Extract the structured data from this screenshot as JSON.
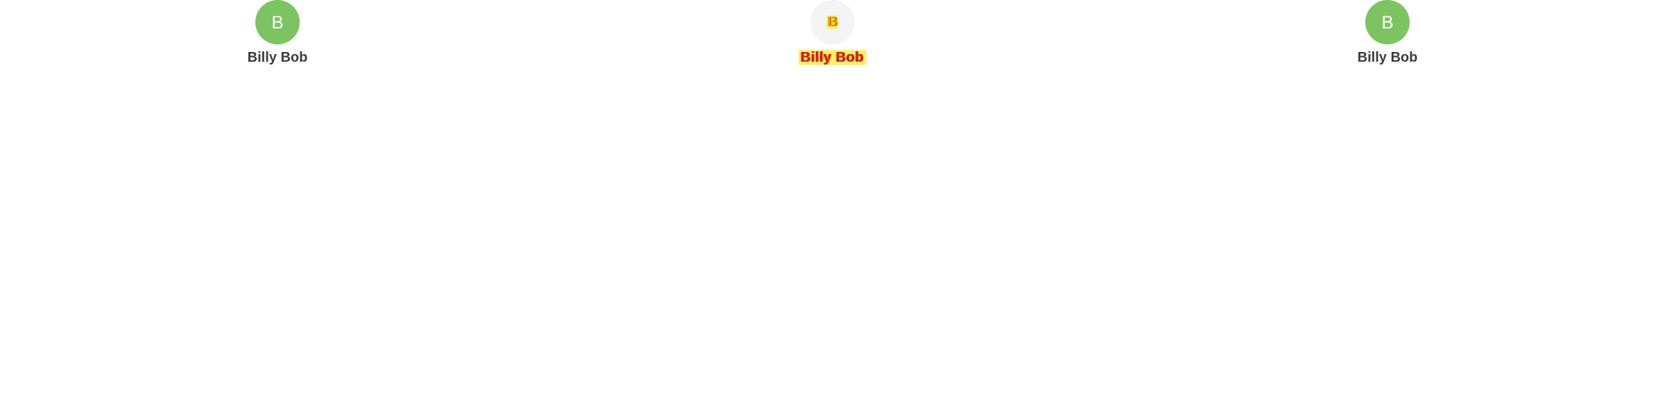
{
  "panels": [
    {
      "avatar": {
        "initial": "B",
        "background": "#7cc462"
      },
      "name": "Billy Bob"
    },
    {
      "avatar": {
        "initial": "B",
        "background": "#f4f4f4",
        "highlight": "#fff36a",
        "mark": "#e01010"
      },
      "name": "Billy Bob"
    },
    {
      "avatar": {
        "initial": "B",
        "background": "#7cc462"
      },
      "name": "Billy Bob"
    }
  ]
}
